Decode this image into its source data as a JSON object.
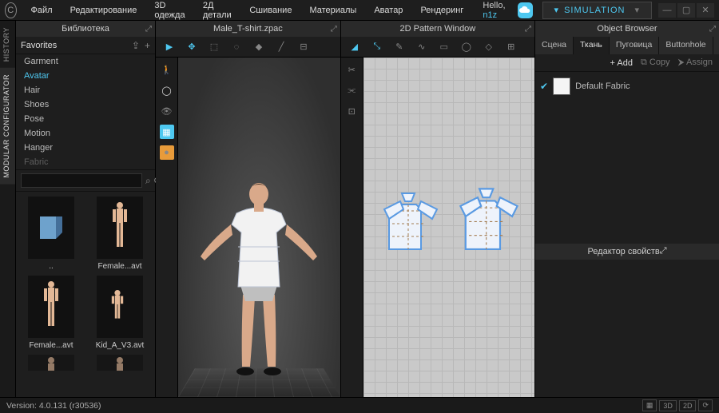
{
  "menu": {
    "items": [
      "Файл",
      "Редактирование",
      "3D одежда",
      "2Д детали",
      "Сшивание",
      "Материалы",
      "Аватар",
      "Рендеринг"
    ],
    "hello_prefix": "Hello, ",
    "hello_user": "n1z",
    "simulation": "SIMULATION"
  },
  "sidetabs": {
    "history": "HISTORY",
    "modular": "MODULAR CONFIGURATOR"
  },
  "library": {
    "title": "Библиотека",
    "favorites": "Favorites",
    "categories": [
      "Garment",
      "Avatar",
      "Hair",
      "Shoes",
      "Pose",
      "Motion",
      "Hanger",
      "Fabric"
    ],
    "active_index": 1,
    "search_placeholder": "",
    "thumbs": [
      "..",
      "Female...avt",
      "Female...avt",
      "Kid_A_V3.avt"
    ]
  },
  "views": {
    "v3d_title": "Male_T-shirt.zpac",
    "v2d_title": "2D Pattern Window"
  },
  "object_browser": {
    "title": "Object Browser",
    "tabs": [
      "Сцена",
      "Ткань",
      "Пуговица",
      "Buttonhole",
      "Сп"
    ],
    "add": "Add",
    "copy": "Copy",
    "assign": "Assign",
    "item": "Default Fabric"
  },
  "property_editor": {
    "title": "Редактор свойств"
  },
  "status": {
    "version": "Version: 4.0.131 (r30536)",
    "btn3d": "3D",
    "btn2d": "2D"
  }
}
